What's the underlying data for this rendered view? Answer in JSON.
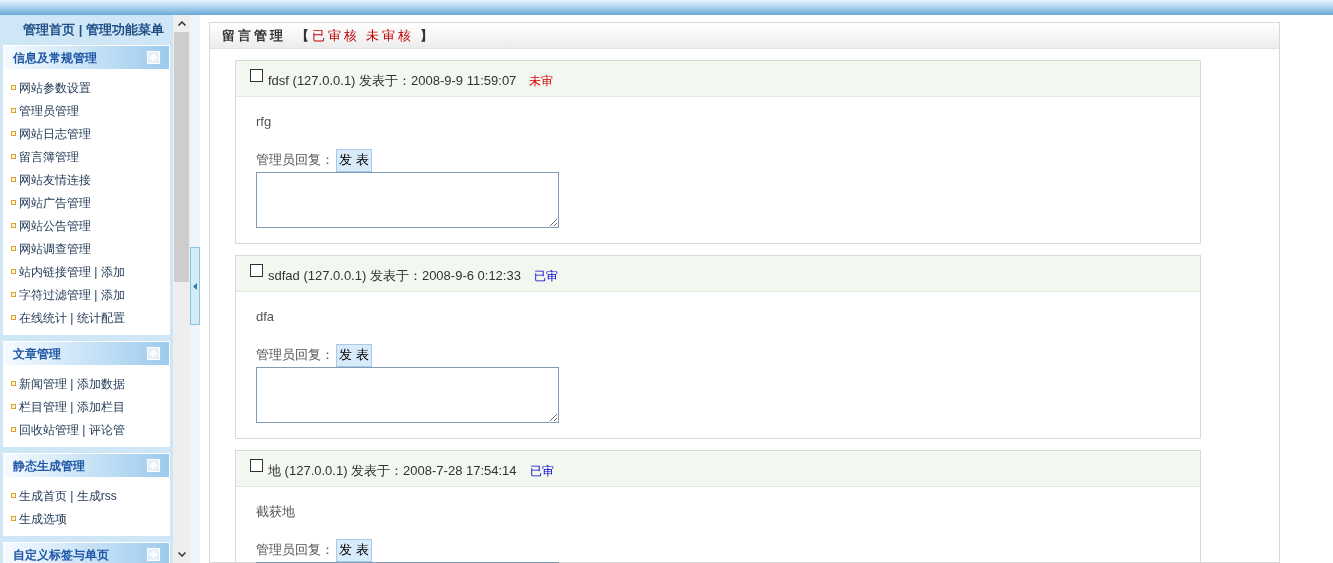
{
  "top_links": "管理首页 | 管理功能菜单",
  "sidebar": [
    {
      "title": "信息及常规管理",
      "items": [
        "网站参数设置",
        "管理员管理",
        "网站日志管理",
        "留言簿管理",
        "网站友情连接",
        "网站广告管理",
        "网站公告管理",
        "网站调查管理",
        "站内链接管理 | 添加",
        "字符过滤管理 | 添加",
        "在线统计 | 统计配置"
      ]
    },
    {
      "title": "文章管理",
      "items": [
        "新闻管理 | 添加数据",
        "栏目管理 | 添加栏目",
        "回收站管理 | 评论管"
      ]
    },
    {
      "title": "静态生成管理",
      "items": [
        "生成首页 | 生成rss",
        "生成选项"
      ]
    },
    {
      "title": "自定义标签与单页"
    }
  ],
  "panel": {
    "title": "留言管理",
    "bracket_open": "【",
    "filters": [
      "已审核",
      "未审核"
    ],
    "bracket_close": "】"
  },
  "messages": [
    {
      "checked": false,
      "author": "fdsf (127.0.0.1) 发表于：2008-9-9 11:59:07",
      "status": "未审",
      "approved": false,
      "body": "rfg",
      "reply_label": "管理员回复：",
      "reply_button": "发 表"
    },
    {
      "checked": false,
      "author": "sdfad (127.0.0.1) 发表于：2008-9-6 0:12:33",
      "status": "已审",
      "approved": true,
      "body": "dfa",
      "reply_label": "管理员回复：",
      "reply_button": "发 表"
    },
    {
      "checked": false,
      "author": "地 (127.0.0.1) 发表于：2008-7-28 17:54:14",
      "status": "已审",
      "approved": true,
      "body": "截获地",
      "reply_label": "管理员回复：",
      "reply_button": "发 表"
    }
  ]
}
